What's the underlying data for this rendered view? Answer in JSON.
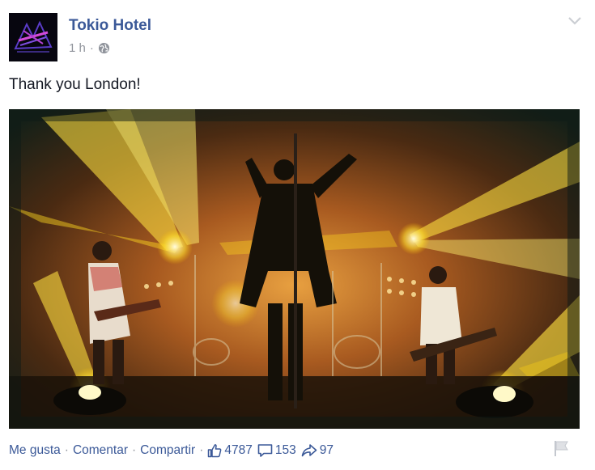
{
  "post": {
    "author": "Tokio Hotel",
    "time": "1 h",
    "separator": "·",
    "message": "Thank you London!",
    "photo_alt": "Band performing on stage under yellow lights"
  },
  "actions": {
    "like": "Me gusta",
    "comment": "Comentar",
    "share": "Compartir",
    "separator": "·",
    "like_count": "4787",
    "comment_count": "153",
    "share_count": "97"
  },
  "colors": {
    "link": "#3b5998",
    "meta": "#90949c",
    "text": "#141823"
  },
  "icons": [
    "globe-icon",
    "chevron-down-icon",
    "thumbs-up-icon",
    "comment-icon",
    "share-icon",
    "flag-icon"
  ]
}
